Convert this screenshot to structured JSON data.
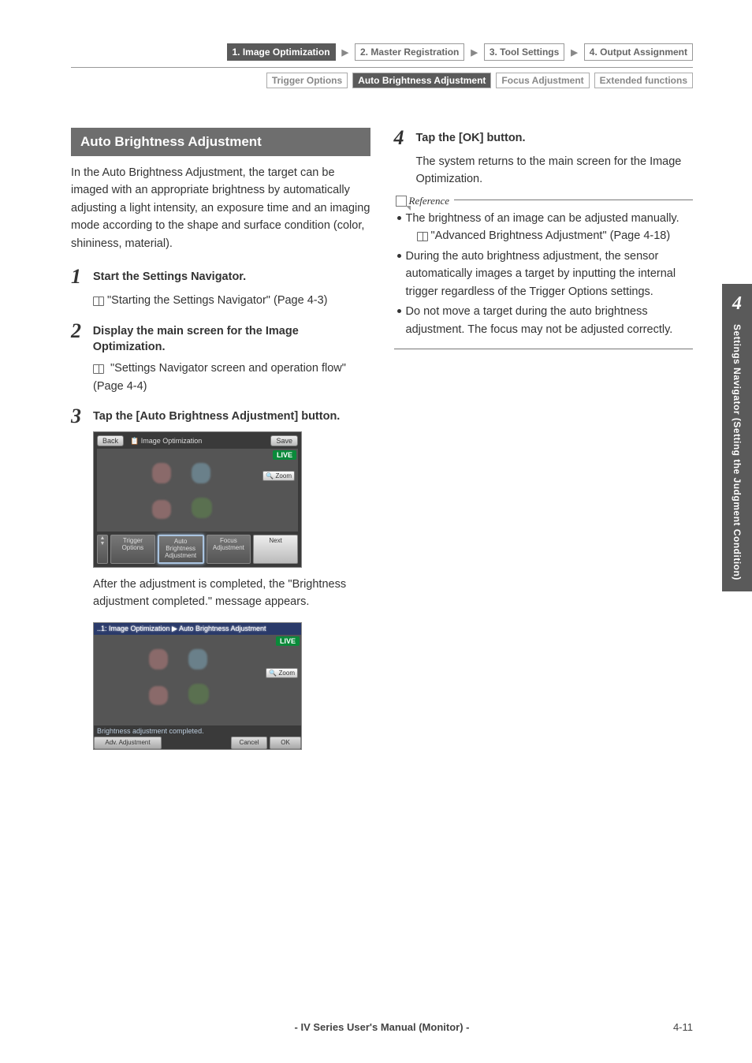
{
  "top_nav": {
    "items": [
      {
        "label": "1. Image Optimization",
        "active": true
      },
      {
        "label": "2. Master Registration",
        "active": false
      },
      {
        "label": "3. Tool Settings",
        "active": false
      },
      {
        "label": "4. Output Assignment",
        "active": false
      }
    ]
  },
  "sub_nav": {
    "items": [
      {
        "label": "Trigger Options",
        "active": false
      },
      {
        "label": "Auto Brightness Adjustment",
        "active": true
      },
      {
        "label": "Focus Adjustment",
        "active": false
      },
      {
        "label": "Extended functions",
        "active": false
      }
    ]
  },
  "section_heading": "Auto Brightness Adjustment",
  "intro": "In the Auto Brightness Adjustment, the target can be imaged with an appropriate brightness by automatically adjusting a light intensity, an exposure time and an imaging mode according to the shape and surface condition (color, shininess, material).",
  "steps": {
    "s1": {
      "num": "1",
      "title": "Start the Settings Navigator.",
      "ref": "\"Starting the Settings Navigator\" (Page 4-3)"
    },
    "s2": {
      "num": "2",
      "title": "Display the main screen for the Image Optimization.",
      "ref": "\"Settings Navigator screen and operation flow\" (Page 4-4)"
    },
    "s3": {
      "num": "3",
      "title": "Tap the [Auto Brightness Adjustment] button.",
      "after": "After the adjustment is completed, the \"Brightness adjustment completed.\" message appears."
    },
    "s4": {
      "num": "4",
      "title": "Tap the [OK] button.",
      "body": "The system returns to the main screen for the Image Optimization."
    }
  },
  "screenshot1": {
    "back": "Back",
    "title": "Image Optimization",
    "save": "Save",
    "live": "LIVE",
    "zoom": "🔍 Zoom",
    "btns": {
      "trigger": "Trigger\nOptions",
      "auto": "Auto\nBrightness\nAdjustment",
      "focus": "Focus\nAdjustment",
      "next": "Next"
    }
  },
  "screenshot2": {
    "title": "..1: Image Optimization ▶ Auto Brightness Adjustment",
    "live": "LIVE",
    "zoom": "🔍 Zoom",
    "status": "Brightness adjustment completed.",
    "adv": "Adv. Adjustment",
    "cancel": "Cancel",
    "ok": "OK"
  },
  "reference": {
    "label": "Reference",
    "items": [
      {
        "text": "The brightness of an image can be adjusted manually.",
        "ref": "\"Advanced Brightness Adjustment\" (Page 4-18)"
      },
      {
        "text": "During the auto brightness adjustment, the sensor automatically images a target by inputting the internal trigger regardless of the Trigger Options settings."
      },
      {
        "text": "Do not move a target during the auto brightness adjustment. The focus may not be adjusted correctly."
      }
    ]
  },
  "side_tab": {
    "num": "4",
    "text": "Settings Navigator (Setting the Judgment Condition)"
  },
  "footer": {
    "center": "- IV Series User's Manual (Monitor) -",
    "page": "4-11"
  }
}
